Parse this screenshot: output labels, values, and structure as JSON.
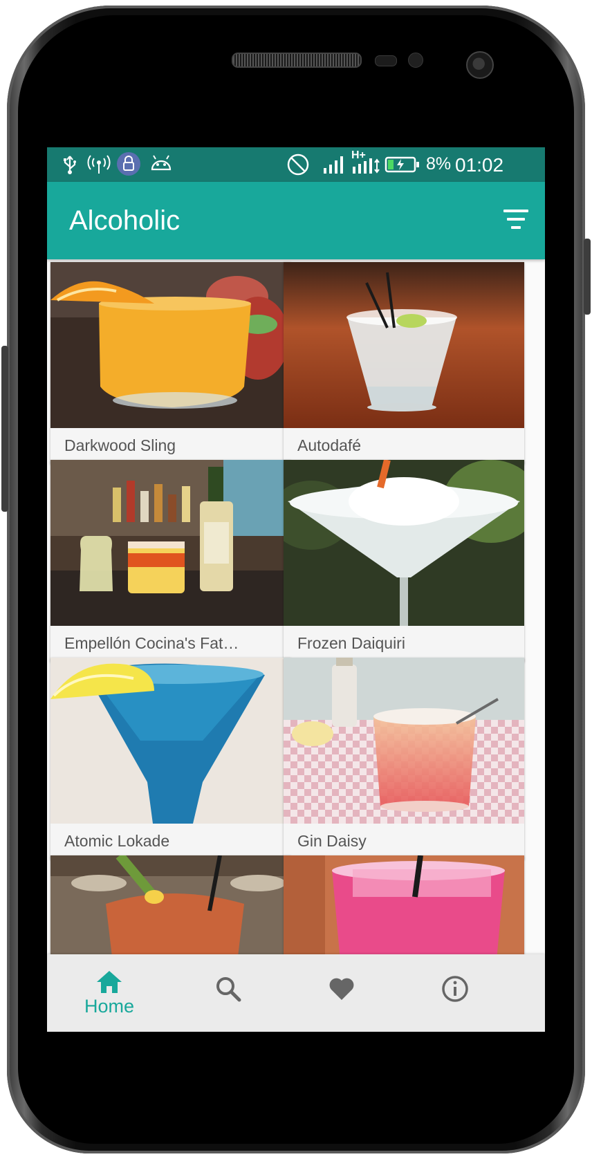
{
  "status_bar": {
    "battery_percent": "8%",
    "time": "01:02",
    "network": "H+",
    "icons": [
      "usb-icon",
      "wifi-hotspot-icon",
      "lock-icon",
      "android-debug-icon",
      "do-not-disturb-icon",
      "signal-icon",
      "data-signal-icon",
      "battery-charging-icon"
    ]
  },
  "app_bar": {
    "title": "Alcoholic",
    "filter_icon": "filter-icon"
  },
  "drinks": [
    {
      "name": "Darkwood Sling"
    },
    {
      "name": "Autodafé"
    },
    {
      "name": "Empellón Cocina's Fat…"
    },
    {
      "name": "Frozen Daiquiri"
    },
    {
      "name": "Atomic Lokade"
    },
    {
      "name": "Gin Daisy"
    },
    {
      "name": ""
    },
    {
      "name": ""
    }
  ],
  "bottom_nav": {
    "items": [
      {
        "label": "Home",
        "icon": "home-icon",
        "active": true
      },
      {
        "label": "",
        "icon": "search-icon",
        "active": false
      },
      {
        "label": "",
        "icon": "heart-icon",
        "active": false
      },
      {
        "label": "",
        "icon": "info-icon",
        "active": false
      }
    ]
  },
  "colors": {
    "primary": "#18a89b",
    "primary_dark": "#177a70",
    "inactive_icon": "#666666"
  }
}
